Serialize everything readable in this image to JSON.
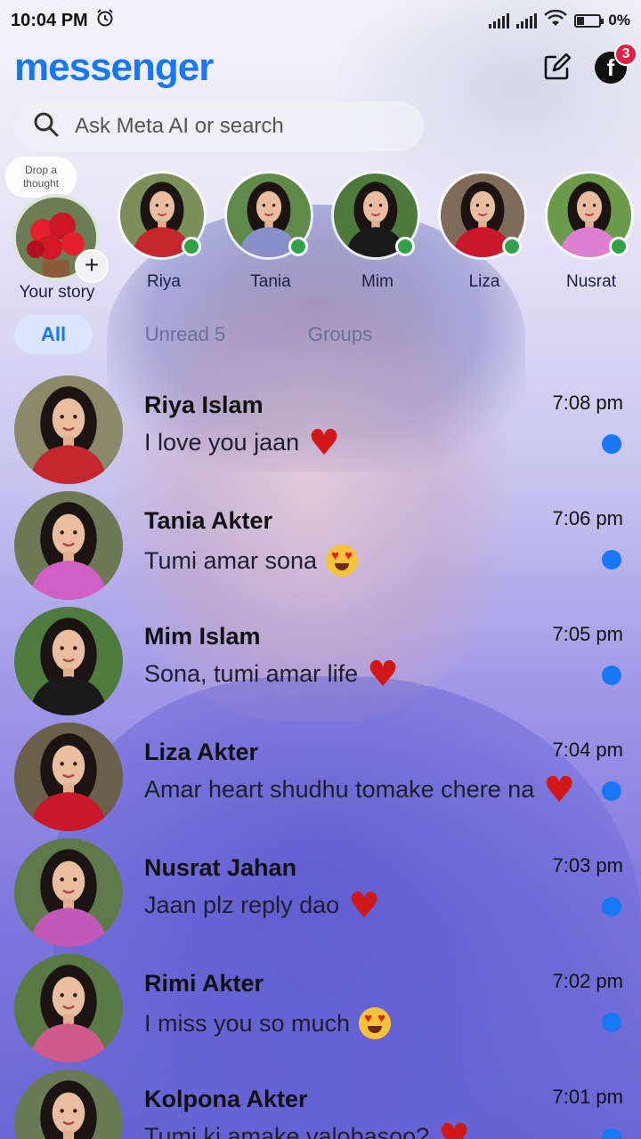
{
  "status_bar": {
    "time": "10:04 PM",
    "battery_text": "0%",
    "battery_level": 0.35
  },
  "header": {
    "logo": "messenger",
    "notification_count": "3"
  },
  "search": {
    "placeholder": "Ask Meta AI or search"
  },
  "stories": {
    "your_story": {
      "thought": "Drop a thought",
      "label": "Your story"
    },
    "items": [
      {
        "label": "Riya",
        "online": true,
        "outfit_color": "#c4282e",
        "bg_color": "#7a8f5a"
      },
      {
        "label": "Tania",
        "online": true,
        "outfit_color": "#8a90c8",
        "bg_color": "#5f8a4a"
      },
      {
        "label": "Mim",
        "online": true,
        "outfit_color": "#1a1a1a",
        "bg_color": "#4e7a3e"
      },
      {
        "label": "Liza",
        "online": true,
        "outfit_color": "#c9192a",
        "bg_color": "#7e6b58"
      },
      {
        "label": "Nusrat",
        "online": true,
        "outfit_color": "#de7fd0",
        "bg_color": "#6e9a4e"
      }
    ]
  },
  "tabs": [
    {
      "label": "All",
      "active": true
    },
    {
      "label": "Unread 5",
      "active": false
    },
    {
      "label": "Groups",
      "active": false
    }
  ],
  "chats": [
    {
      "name": "Riya Islam",
      "message": "I love you jaan",
      "emoji": "heart",
      "time": "7:08 pm",
      "unread": true,
      "outfit_color": "#c4282e",
      "bg_color": "#8a8a6a"
    },
    {
      "name": "Tania Akter",
      "message": "Tumi amar sona",
      "emoji": "heart-eyes",
      "time": "7:06 pm",
      "unread": true,
      "outfit_color": "#d160c4",
      "bg_color": "#6b7a55"
    },
    {
      "name": "Mim Islam",
      "message": "Sona, tumi amar life",
      "emoji": "heart",
      "time": "7:05 pm",
      "unread": true,
      "outfit_color": "#1a1a1a",
      "bg_color": "#4f7a40"
    },
    {
      "name": "Liza Akter",
      "message": "Amar heart shudhu tomake chere na",
      "emoji": "heart",
      "time": "7:04 pm",
      "unread": true,
      "outfit_color": "#c9192a",
      "bg_color": "#6a5f4a"
    },
    {
      "name": "Nusrat Jahan",
      "message": "Jaan plz reply dao",
      "emoji": "heart",
      "time": "7:03 pm",
      "unread": true,
      "outfit_color": "#c45ab8",
      "bg_color": "#5f7a4a"
    },
    {
      "name": "Rimi Akter",
      "message": "I miss you so much",
      "emoji": "heart-eyes",
      "time": "7:02 pm",
      "unread": true,
      "outfit_color": "#d05a8e",
      "bg_color": "#5a7a45"
    },
    {
      "name": "Kolpona Akter",
      "message": "Tumi ki amake valobasoo?",
      "emoji": "heart",
      "time": "7:01 pm",
      "unread": true,
      "outfit_color": "#b23a6a",
      "bg_color": "#6a7a55"
    }
  ]
}
